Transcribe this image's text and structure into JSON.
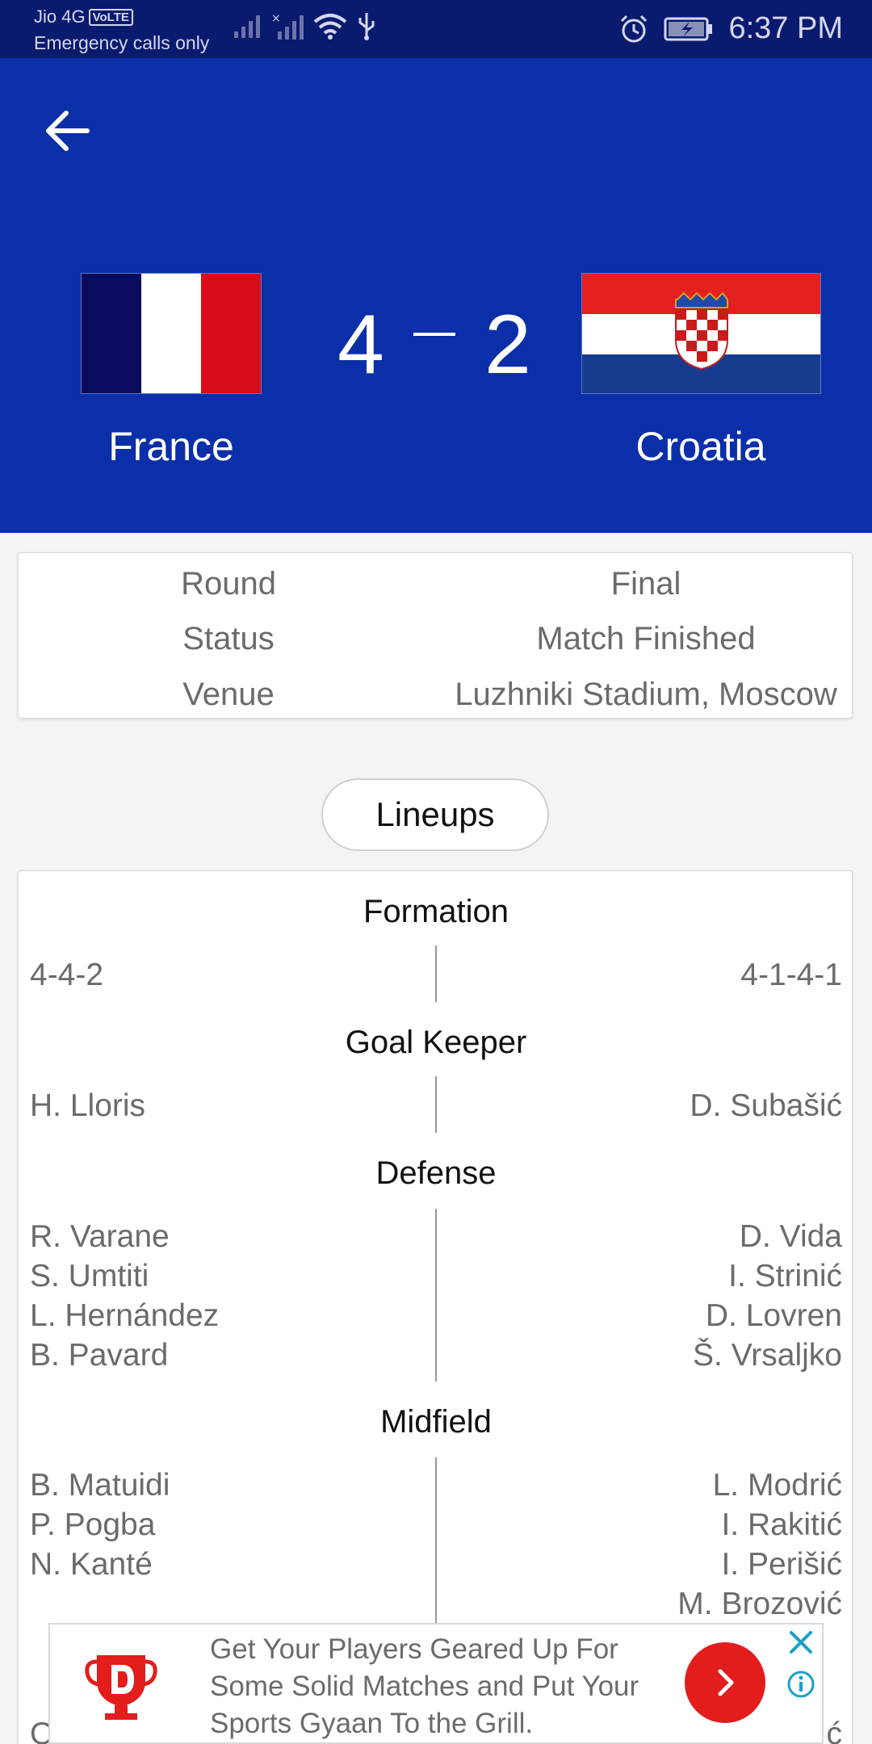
{
  "status_bar": {
    "carrier": "Jio 4G",
    "volte": "VoLTE",
    "emergency": "Emergency calls only",
    "time": "6:37 PM",
    "icons": [
      "signal-icon",
      "wifi-icon",
      "usb-icon",
      "alarm-icon",
      "battery-charging-icon"
    ]
  },
  "header": {
    "back_icon": "back-arrow-icon",
    "home": {
      "name": "France",
      "score": "4",
      "flag_colors": [
        "#0a0a5e",
        "#ffffff",
        "#d90a1a"
      ]
    },
    "away": {
      "name": "Croatia",
      "score": "2",
      "flag_colors": [
        "#e41f1f",
        "#ffffff",
        "#173b8f"
      ]
    },
    "background_color": "#0a2fa8"
  },
  "info": [
    {
      "label": "Round",
      "value": "Final"
    },
    {
      "label": "Status",
      "value": "Match Finished"
    },
    {
      "label": "Venue",
      "value": "Luzhniki Stadium, Moscow"
    }
  ],
  "lineups_button": "Lineups",
  "lineups": {
    "formation": {
      "title": "Formation",
      "home": [
        "4-4-2"
      ],
      "away": [
        "4-1-4-1"
      ]
    },
    "goalkeeper": {
      "title": "Goal Keeper",
      "home": [
        "H. Lloris"
      ],
      "away": [
        "D. Subašić"
      ]
    },
    "defense": {
      "title": "Defense",
      "home": [
        "R. Varane",
        "S. Umtiti",
        "L. Hernández",
        "B. Pavard"
      ],
      "away": [
        "D. Vida",
        "I. Strinić",
        "D. Lovren",
        "Š. Vrsaljko"
      ]
    },
    "midfield": {
      "title": "Midfield",
      "home": [
        "B. Matuidi",
        "P. Pogba",
        "N. Kanté"
      ],
      "away": [
        "L. Modrić",
        "I. Rakitić",
        "I. Perišić",
        "M. Brozović"
      ]
    },
    "partial_row": {
      "home": "O",
      "away": "ć"
    }
  },
  "ad": {
    "text": "Get Your Players Geared Up For Some Solid Matches and Put Your Sports Gyaan To the Grill.",
    "logo_icon": "dream11-logo-icon",
    "cta_icon": "chevron-right-icon",
    "close_icon": "close-icon",
    "info_icon": "info-icon",
    "accent": "#e31c1c"
  }
}
